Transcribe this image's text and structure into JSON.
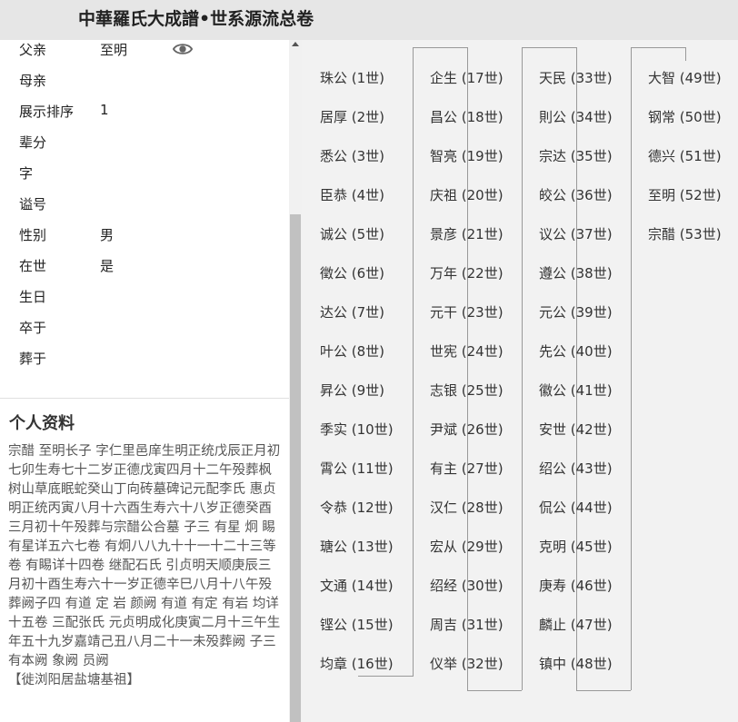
{
  "header": {
    "title": "中華羅氏大成譜•世系源流总卷"
  },
  "fields": [
    {
      "label": "父亲",
      "value": "至明"
    },
    {
      "label": "母亲",
      "value": ""
    },
    {
      "label": "展示排序",
      "value": "1"
    },
    {
      "label": "辈分",
      "value": ""
    },
    {
      "label": "字",
      "value": ""
    },
    {
      "label": "谥号",
      "value": ""
    },
    {
      "label": "性别",
      "value": "男"
    },
    {
      "label": "在世",
      "value": "是"
    },
    {
      "label": "生日",
      "value": ""
    },
    {
      "label": "卒于",
      "value": ""
    },
    {
      "label": "葬于",
      "value": ""
    }
  ],
  "profile": {
    "title": "个人资料",
    "bio": "宗醋 至明长子 字仁里邑庠生明正统戊辰正月初七卯生寿七十二岁正德戊寅四月十二午殁葬枫树山草底眠蛇癸山丁向砖墓碑记元配李氏 惠贞明正统丙寅八月十六酉生寿六十八岁正德癸酉三月初十午殁葬与宗醋公合墓 子三 有星 炯 睗 有星详五六七卷 有炯八八九十十一十二十三等卷 有睗详十四卷 继配石氏 引贞明天顺庚辰三月初十酉生寿六十一岁正德辛巳八月十八午殁葬阙子四 有道 定 岩 颜阙 有道 有定 有岩 均详十五卷 三配张氏 元贞明成化庚寅二月十三午生年五十九岁嘉靖己丑八月二十一未殁葬阙 子三 有本阙 象阙 员阙",
    "note": "【徙浏阳居盐塘基祖】"
  },
  "generations": [
    [
      "珠公 (1世)",
      "居厚 (2世)",
      "悉公 (3世)",
      "臣恭 (4世)",
      "诚公 (5世)",
      "徵公 (6世)",
      "达公 (7世)",
      "叶公 (8世)",
      "昇公 (9世)",
      "季实 (10世)",
      "霄公 (11世)",
      "令恭 (12世)",
      "瑭公 (13世)",
      "文通 (14世)",
      "铿公 (15世)",
      "均章 (16世)"
    ],
    [
      "企生 (17世)",
      "昌公 (18世)",
      "智亮 (19世)",
      "庆祖 (20世)",
      "景彦 (21世)",
      "万年 (22世)",
      "元干 (23世)",
      "世宪 (24世)",
      "志银 (25世)",
      "尹斌 (26世)",
      "有主 (27世)",
      "汉仁 (28世)",
      "宏从 (29世)",
      "绍经 (30世)",
      "周吉 (31世)",
      "仪举 (32世)"
    ],
    [
      "天民 (33世)",
      "則公 (34世)",
      "宗达 (35世)",
      "皎公 (36世)",
      "议公 (37世)",
      "遵公 (38世)",
      "元公 (39世)",
      "先公 (40世)",
      "徽公 (41世)",
      "安世 (42世)",
      "绍公 (43世)",
      "侃公 (44世)",
      "克明 (45世)",
      "庚寿 (46世)",
      "麟止 (47世)",
      "镇中 (48世)"
    ],
    [
      "大智 (49世)",
      "钢常 (50世)",
      "德兴 (51世)",
      "至明 (52世)",
      "宗醋 (53世)"
    ]
  ]
}
